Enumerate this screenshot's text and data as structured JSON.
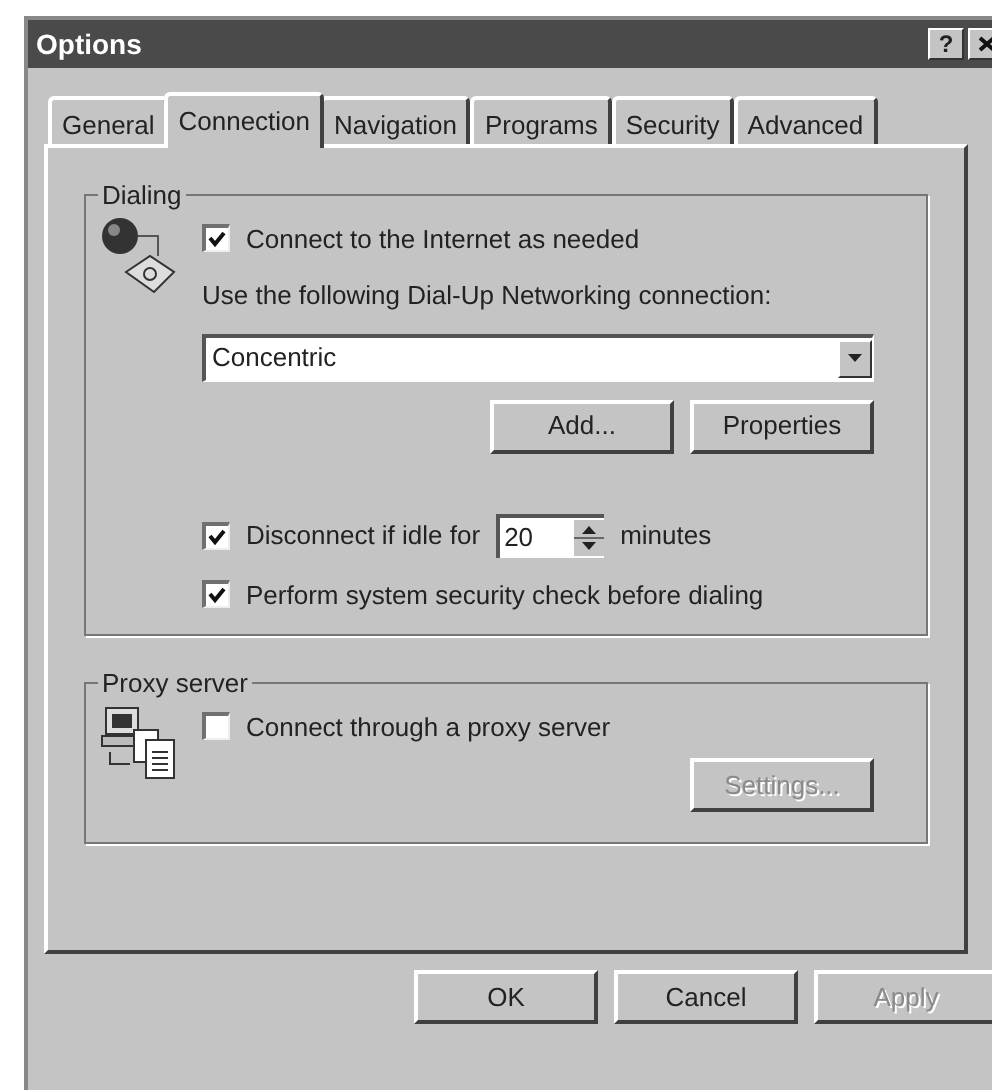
{
  "window": {
    "title": "Options",
    "help_button": "?"
  },
  "tabs": [
    {
      "label": "General",
      "selected": false
    },
    {
      "label": "Connection",
      "selected": true
    },
    {
      "label": "Navigation",
      "selected": false
    },
    {
      "label": "Programs",
      "selected": false
    },
    {
      "label": "Security",
      "selected": false
    },
    {
      "label": "Advanced",
      "selected": false
    }
  ],
  "dialing": {
    "title": "Dialing",
    "connect_checkbox": {
      "label": "Connect to the Internet as needed",
      "checked": true
    },
    "use_label": "Use the following Dial-Up Networking connection:",
    "connection_select": {
      "value": "Concentric"
    },
    "buttons": [
      {
        "label": "Add...",
        "disabled": false
      },
      {
        "label": "Properties",
        "disabled": false
      }
    ],
    "idle": {
      "label": "Disconnect if idle for",
      "checked": true,
      "value": "20",
      "unit": "minutes"
    },
    "security_check": {
      "label": "Perform system security check before dialing",
      "checked": true
    }
  },
  "proxy": {
    "title": "Proxy server",
    "checkbox": {
      "label": "Connect through a proxy server",
      "checked": false
    },
    "settings_button": {
      "label": "Settings...",
      "disabled": true
    }
  },
  "footer_buttons": [
    {
      "label": "OK",
      "disabled": false
    },
    {
      "label": "Cancel",
      "disabled": false
    },
    {
      "label": "Apply",
      "disabled": true
    }
  ]
}
